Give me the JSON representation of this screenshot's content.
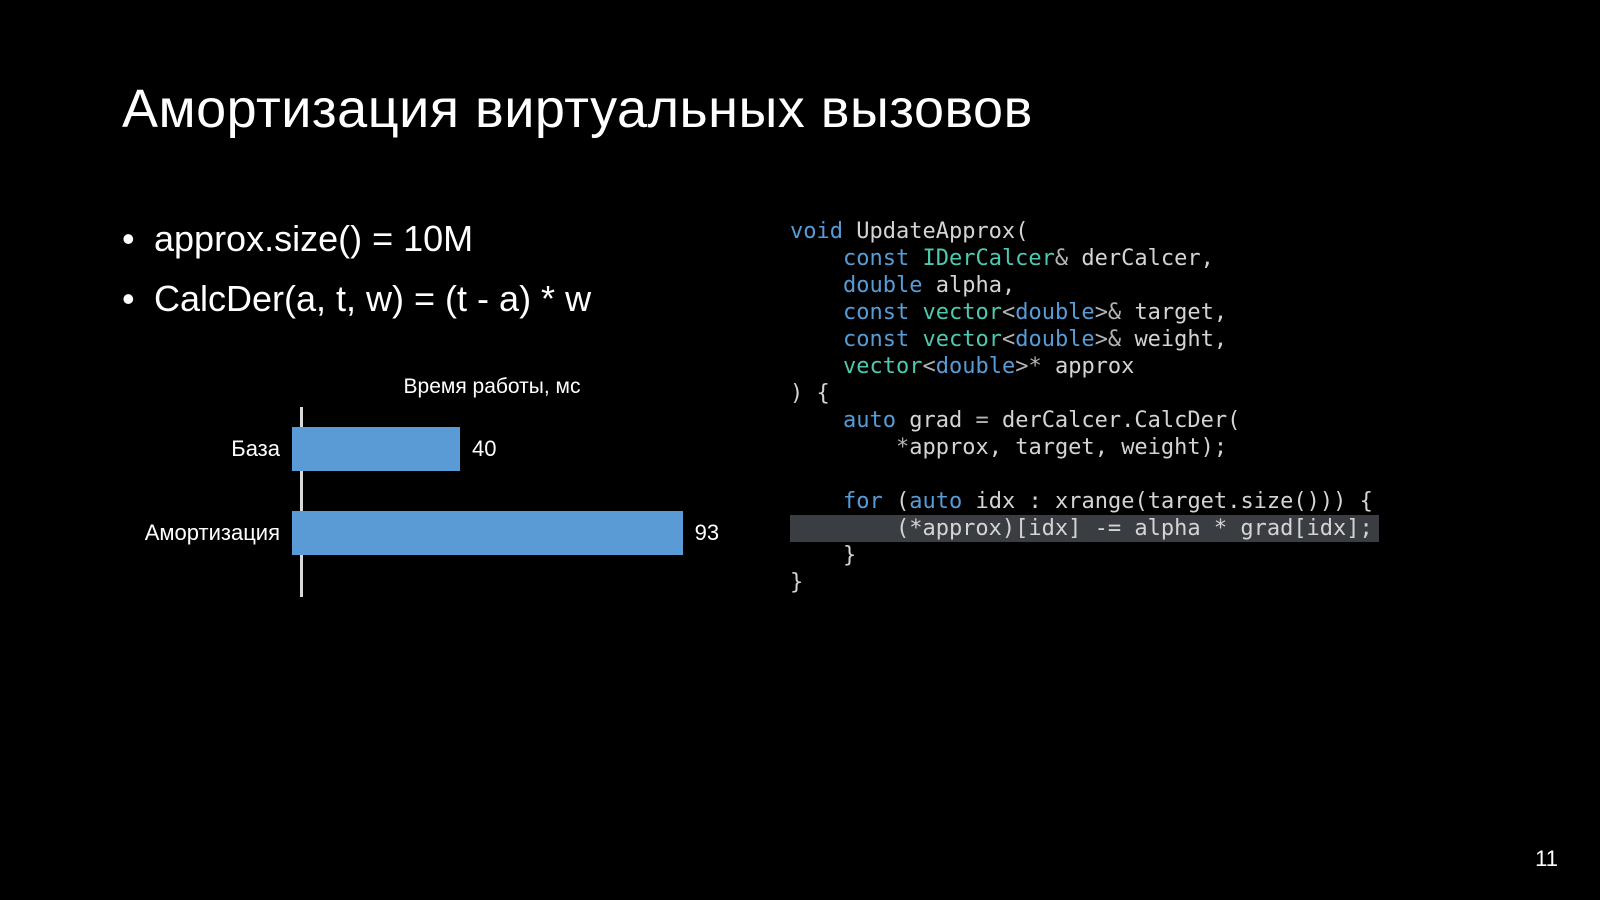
{
  "title": "Амортизация виртуальных вызовов",
  "bullets": [
    "approx.size() = 10M",
    "CalcDer(a, t, w) = (t - a) * w"
  ],
  "chart_data": {
    "type": "bar",
    "orientation": "horizontal",
    "title": "Время работы, мс",
    "categories": [
      "База",
      "Амортизация"
    ],
    "values": [
      40,
      93
    ],
    "xlim": [
      0,
      100
    ],
    "bar_color": "#5b9bd5",
    "xlabel": "",
    "ylabel": ""
  },
  "code": {
    "tokens": [
      [
        [
          "kw",
          "void"
        ],
        [
          "p",
          " "
        ],
        [
          "id",
          "UpdateApprox"
        ],
        [
          "p",
          "("
        ]
      ],
      [
        [
          "p",
          "    "
        ],
        [
          "kw",
          "const"
        ],
        [
          "p",
          " "
        ],
        [
          "type",
          "IDerCalcer"
        ],
        [
          "op",
          "&"
        ],
        [
          "p",
          " "
        ],
        [
          "id",
          "derCalcer"
        ],
        [
          "p",
          ","
        ]
      ],
      [
        [
          "p",
          "    "
        ],
        [
          "kw",
          "double"
        ],
        [
          "p",
          " "
        ],
        [
          "id",
          "alpha"
        ],
        [
          "p",
          ","
        ]
      ],
      [
        [
          "p",
          "    "
        ],
        [
          "kw",
          "const"
        ],
        [
          "p",
          " "
        ],
        [
          "type",
          "vector"
        ],
        [
          "op",
          "<"
        ],
        [
          "kw",
          "double"
        ],
        [
          "op",
          ">&"
        ],
        [
          "p",
          " "
        ],
        [
          "id",
          "target"
        ],
        [
          "p",
          ","
        ]
      ],
      [
        [
          "p",
          "    "
        ],
        [
          "kw",
          "const"
        ],
        [
          "p",
          " "
        ],
        [
          "type",
          "vector"
        ],
        [
          "op",
          "<"
        ],
        [
          "kw",
          "double"
        ],
        [
          "op",
          ">&"
        ],
        [
          "p",
          " "
        ],
        [
          "id",
          "weight"
        ],
        [
          "p",
          ","
        ]
      ],
      [
        [
          "p",
          "    "
        ],
        [
          "type",
          "vector"
        ],
        [
          "op",
          "<"
        ],
        [
          "kw",
          "double"
        ],
        [
          "op",
          ">*"
        ],
        [
          "p",
          " "
        ],
        [
          "id",
          "approx"
        ]
      ],
      [
        [
          "p",
          ") {"
        ]
      ],
      [
        [
          "p",
          "    "
        ],
        [
          "kw",
          "auto"
        ],
        [
          "p",
          " "
        ],
        [
          "id",
          "grad"
        ],
        [
          "p",
          " "
        ],
        [
          "op",
          "="
        ],
        [
          "p",
          " "
        ],
        [
          "id",
          "derCalcer"
        ],
        [
          "p",
          "."
        ],
        [
          "id",
          "CalcDer"
        ],
        [
          "p",
          "("
        ]
      ],
      [
        [
          "p",
          "        "
        ],
        [
          "op",
          "*"
        ],
        [
          "id",
          "approx"
        ],
        [
          "p",
          ", "
        ],
        [
          "id",
          "target"
        ],
        [
          "p",
          ", "
        ],
        [
          "id",
          "weight"
        ],
        [
          "p",
          ");"
        ]
      ],
      [],
      [
        [
          "p",
          "    "
        ],
        [
          "kw",
          "for"
        ],
        [
          "p",
          " ("
        ],
        [
          "kw",
          "auto"
        ],
        [
          "p",
          " "
        ],
        [
          "id",
          "idx"
        ],
        [
          "p",
          " : "
        ],
        [
          "id",
          "xrange"
        ],
        [
          "p",
          "("
        ],
        [
          "id",
          "target"
        ],
        [
          "p",
          "."
        ],
        [
          "id",
          "size"
        ],
        [
          "p",
          "())) {"
        ]
      ],
      [
        [
          "p",
          "        (*approx)[idx] -= alpha * grad[idx];"
        ]
      ],
      [
        [
          "p",
          "    }"
        ]
      ],
      [
        [
          "p",
          "}"
        ]
      ]
    ],
    "highlight_line": 11
  },
  "page_number": "11"
}
